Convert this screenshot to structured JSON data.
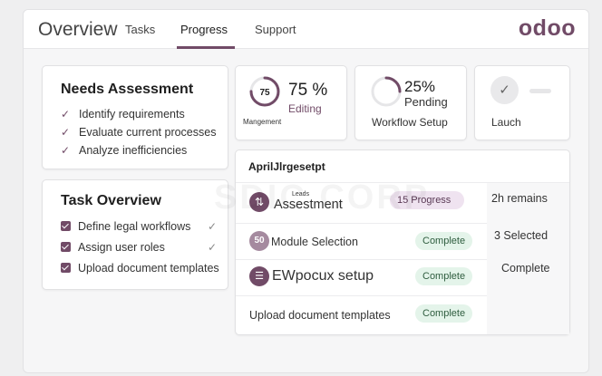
{
  "header": {
    "title": "Overview",
    "tabs": [
      {
        "label": "Tasks"
      },
      {
        "label": "Progress"
      },
      {
        "label": "Support"
      }
    ],
    "logo": "odoo"
  },
  "needs_assessment": {
    "title": "Needs Assessment",
    "items": [
      "Identify requirements",
      "Evaluate current processes",
      "Analyze inefficiencies"
    ]
  },
  "task_overview": {
    "title": "Task Overview",
    "items": [
      "Define legal workflows",
      "Assign user roles",
      "Upload document templates"
    ]
  },
  "stats": {
    "management": {
      "gauge_value": "75",
      "percent": "75 %",
      "status": "Editing",
      "label": "Mangement",
      "progress": 0.75
    },
    "workflow": {
      "percent": "25%",
      "status": "Pending",
      "label": "Workflow Setup",
      "progress": 0.25
    },
    "launch": {
      "label": "Lauch"
    }
  },
  "table": {
    "heading": "AprilJlrgesetpt",
    "rows": [
      {
        "small": "Leads",
        "name": "Assestment",
        "badge": "15 Progress",
        "side": "2h remains"
      },
      {
        "icon_text": "50",
        "name": "Module Selection",
        "badge": "Complete",
        "side": "3 Selected"
      },
      {
        "name": "EWpocux setup",
        "badge": "Complete",
        "side": "Complete"
      },
      {
        "name": "Upload document templates",
        "badge": "Complete",
        "side": ""
      }
    ]
  },
  "watermark": "SDIC CORP",
  "colors": {
    "accent": "#714b67",
    "success_bg": "#e4f4ea"
  }
}
